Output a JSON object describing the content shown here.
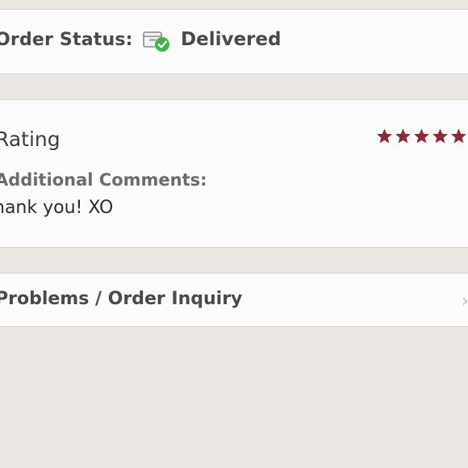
{
  "order_status": {
    "label": "Order Status:",
    "value": "Delivered",
    "icon": "package-delivered-icon",
    "check_color": "#3cb64a"
  },
  "rating": {
    "title": "Rating",
    "stars": 5,
    "max_stars": 5,
    "star_color": "#8b2a3a",
    "comments_label": "Additional Comments:",
    "comments_text": "hank you! XO"
  },
  "problems": {
    "label": "Problems / Order Inquiry",
    "chevron": "›"
  }
}
